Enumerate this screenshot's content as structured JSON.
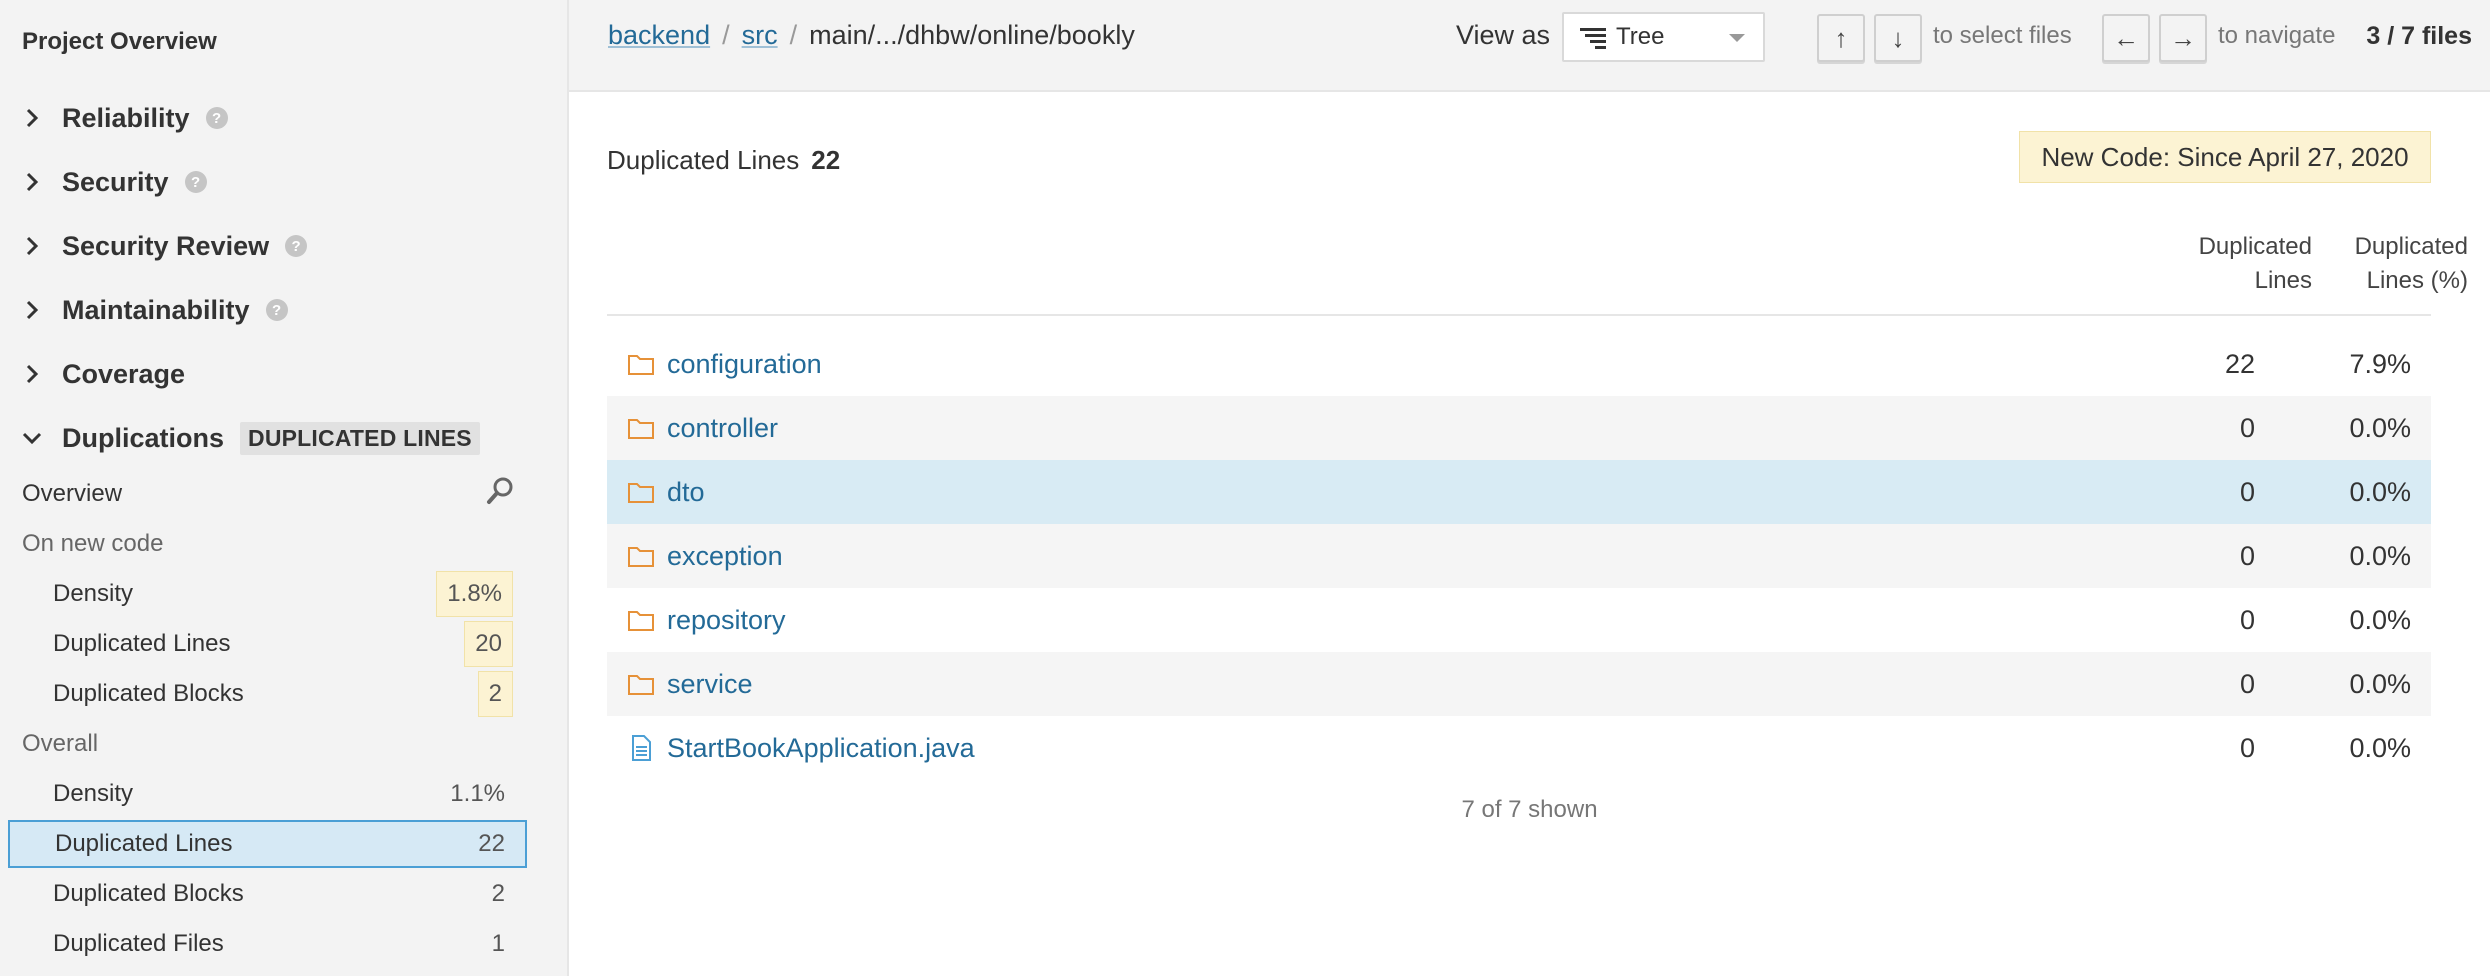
{
  "sidebar": {
    "title": "Project Overview",
    "domains": [
      {
        "label": "Reliability",
        "help": "?"
      },
      {
        "label": "Security",
        "help": "?"
      },
      {
        "label": "Security Review",
        "help": "?"
      },
      {
        "label": "Maintainability",
        "help": "?"
      },
      {
        "label": "Coverage"
      },
      {
        "label": "Duplications",
        "badge": "DUPLICATED LINES"
      }
    ],
    "overview_label": "Overview",
    "new_code": {
      "category": "On new code",
      "items": [
        {
          "label": "Density",
          "value": "1.8%"
        },
        {
          "label": "Duplicated Lines",
          "value": "20"
        },
        {
          "label": "Duplicated Blocks",
          "value": "2"
        }
      ]
    },
    "overall": {
      "category": "Overall",
      "items": [
        {
          "label": "Density",
          "value": "1.1%"
        },
        {
          "label": "Duplicated Lines",
          "value": "22"
        },
        {
          "label": "Duplicated Blocks",
          "value": "2"
        },
        {
          "label": "Duplicated Files",
          "value": "1"
        }
      ]
    }
  },
  "topbar": {
    "breadcrumb": [
      {
        "label": "backend"
      },
      {
        "label": "src"
      },
      {
        "label": "main/.../dhbw/online/bookly"
      }
    ],
    "separator": "/",
    "view_as_label": "View as",
    "view_value": "Tree",
    "up_key": "↑",
    "down_key": "↓",
    "select_hint": "to select files",
    "left_key": "←",
    "right_key": "→",
    "navigate_hint": "to navigate",
    "files_count": "3 / 7 files"
  },
  "main": {
    "metric_label": "Duplicated Lines",
    "metric_value": "22",
    "new_code_badge": "New Code: Since April 27, 2020",
    "columns": [
      {
        "line1": "Duplicated",
        "line2": "Lines"
      },
      {
        "line1": "Duplicated",
        "line2": "Lines (%)"
      }
    ],
    "rows": [
      {
        "name": "configuration",
        "type": "folder",
        "lines": "22",
        "percent": "7.9%"
      },
      {
        "name": "controller",
        "type": "folder",
        "lines": "0",
        "percent": "0.0%"
      },
      {
        "name": "dto",
        "type": "folder",
        "lines": "0",
        "percent": "0.0%"
      },
      {
        "name": "exception",
        "type": "folder",
        "lines": "0",
        "percent": "0.0%"
      },
      {
        "name": "repository",
        "type": "folder",
        "lines": "0",
        "percent": "0.0%"
      },
      {
        "name": "service",
        "type": "folder",
        "lines": "0",
        "percent": "0.0%"
      },
      {
        "name": "StartBookApplication.java",
        "type": "file",
        "lines": "0",
        "percent": "0.0%"
      }
    ],
    "shown_text": "7 of 7 shown"
  },
  "colors": {
    "link": "#236a97",
    "selected_bg": "#d6e9f5",
    "selected_border": "#4b9fd5",
    "highlight_bg": "#fcf3d3",
    "folder_icon": "#e69138",
    "file_icon": "#4b9fd5"
  },
  "icons": {
    "collapsed": "chevron-right-icon",
    "expanded": "chevron-down-icon",
    "help": "help-icon",
    "search": "search-icon",
    "folder": "folder-icon",
    "file": "file-icon",
    "tree": "tree-icon"
  }
}
